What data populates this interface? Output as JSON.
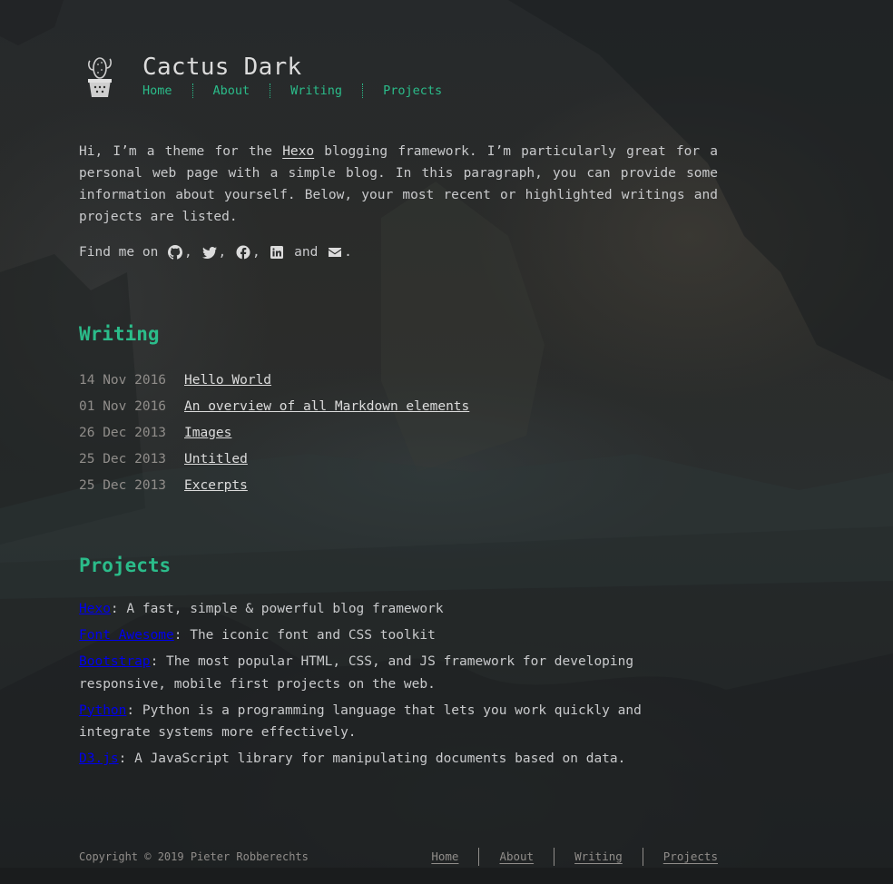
{
  "site": {
    "title": "Cactus Dark",
    "logo_icon": "cactus-logo-icon",
    "accent_color": "#2bbc8a"
  },
  "nav": {
    "items": [
      {
        "label": "Home"
      },
      {
        "label": "About"
      },
      {
        "label": "Writing"
      },
      {
        "label": "Projects"
      }
    ]
  },
  "intro": {
    "part1": "Hi, I’m a theme for the ",
    "hexo_link": "Hexo",
    "part2": " blogging framework. I’m particularly great for a personal web page with a simple blog. In this paragraph, you can provide some information about yourself. Below, your most recent or highlighted writings and projects are listed."
  },
  "findme": {
    "prefix": "Find me on ",
    "and": " and ",
    "suffix": ".",
    "icons": [
      "github-icon",
      "twitter-icon",
      "facebook-icon",
      "linkedin-icon",
      "envelope-icon"
    ]
  },
  "writing": {
    "heading": "Writing",
    "posts": [
      {
        "date": "14 Nov 2016",
        "title": "Hello World"
      },
      {
        "date": "01 Nov 2016",
        "title": "An overview of all Markdown elements"
      },
      {
        "date": "26 Dec 2013",
        "title": "Images"
      },
      {
        "date": "25 Dec 2013",
        "title": "Untitled"
      },
      {
        "date": "25 Dec 2013",
        "title": "Excerpts"
      }
    ]
  },
  "projects": {
    "heading": "Projects",
    "items": [
      {
        "name": "Hexo",
        "desc": ": A fast, simple & powerful blog framework"
      },
      {
        "name": "Font Awesome",
        "desc": ": The iconic font and CSS toolkit"
      },
      {
        "name": "Bootstrap",
        "desc": ": The most popular HTML, CSS, and JS framework for developing responsive, mobile first projects on the web."
      },
      {
        "name": "Python",
        "desc": ": Python is a programming language that lets you work quickly and integrate systems more effectively."
      },
      {
        "name": "D3.js",
        "desc": ": A JavaScript library for manipulating documents based on data."
      }
    ]
  },
  "footer": {
    "copyright": "Copyright © 2019 Pieter Robberechts",
    "nav": [
      {
        "label": "Home"
      },
      {
        "label": "About"
      },
      {
        "label": "Writing"
      },
      {
        "label": "Projects"
      }
    ]
  }
}
